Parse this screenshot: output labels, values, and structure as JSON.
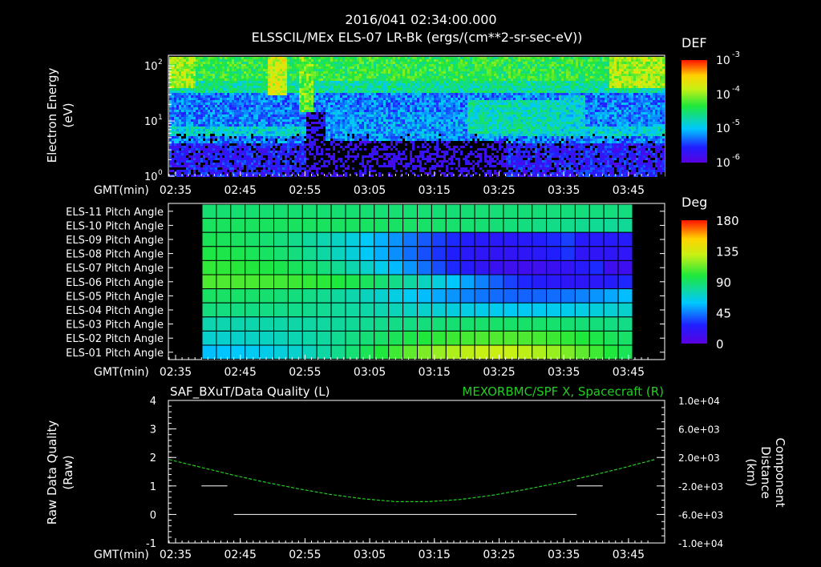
{
  "header": {
    "timestamp": "2016/041 02:34:00.000",
    "title": "ELSSCIL/MEx ELS-07 LR-Bk  (ergs/(cm**2-sr-sec-eV))"
  },
  "time_axis": {
    "label": "GMT(min)",
    "ticks": [
      "02:35",
      "02:45",
      "02:55",
      "03:05",
      "03:15",
      "03:25",
      "03:35",
      "03:45"
    ]
  },
  "chart_data": [
    {
      "type": "heatmap",
      "name": "electron-energy-spectrogram",
      "ylabel": [
        "Electron Energy",
        "(eV)"
      ],
      "y_scale": "log",
      "ylim": [
        1,
        150
      ],
      "y_ticks": [
        {
          "base": "10",
          "exp": "0"
        },
        {
          "base": "10",
          "exp": "1"
        },
        {
          "base": "10",
          "exp": "2"
        }
      ],
      "colorbar": {
        "label": "DEF",
        "ticks": [
          {
            "base": "10",
            "exp": "-3"
          },
          {
            "base": "10",
            "exp": "-4"
          },
          {
            "base": "10",
            "exp": "-5"
          },
          {
            "base": "10",
            "exp": "-6"
          }
        ]
      }
    },
    {
      "type": "heatmap",
      "name": "pitch-angle-map",
      "rows": [
        "ELS-11 Pitch Angle",
        "ELS-10 Pitch Angle",
        "ELS-09 Pitch Angle",
        "ELS-08 Pitch Angle",
        "ELS-07 Pitch Angle",
        "ELS-06 Pitch Angle",
        "ELS-05 Pitch Angle",
        "ELS-04 Pitch Angle",
        "ELS-03 Pitch Angle",
        "ELS-02 Pitch Angle",
        "ELS-01 Pitch Angle"
      ],
      "colorbar": {
        "label": "Deg",
        "ticks": [
          "180",
          "135",
          "90",
          "45",
          "0"
        ],
        "range": [
          0,
          180
        ]
      },
      "columns": 30,
      "row_start_deg": [
        88,
        92,
        96,
        100,
        104,
        108,
        92,
        86,
        75,
        68,
        55
      ],
      "row_min_deg": [
        85,
        80,
        22,
        18,
        12,
        20,
        40,
        62,
        90,
        108,
        130
      ],
      "min_minute_offset": [
        70,
        65,
        45,
        45,
        48,
        55,
        48,
        48,
        46,
        45,
        44
      ]
    },
    {
      "type": "line",
      "name": "data-quality-and-component-distance",
      "title_left": "SAF_BXuT/Data Quality (L)",
      "title_right": "MEXORBMC/SPF X, Spacecraft (R)",
      "ylabel_left": [
        "Raw Data Quality",
        "(Raw)"
      ],
      "ylabel_right": [
        "Component",
        "Distance",
        "(km)"
      ],
      "ylim_left": [
        -1,
        4
      ],
      "y_ticks_left": [
        "4",
        "3",
        "2",
        "1",
        "0",
        "-1"
      ],
      "ylim_right": [
        -10000,
        10000
      ],
      "y_ticks_right": [
        "1.0e+04",
        "6.0e+03",
        "2.0e+03",
        "-2.0e+03",
        "-6.0e+03",
        "-1.0e+04"
      ],
      "series": [
        {
          "color": "#ffffff",
          "segments": [
            {
              "x": [
                "02:39",
                "02:43"
              ],
              "y": [
                1,
                1
              ]
            },
            {
              "x": [
                "02:44",
                "03:37"
              ],
              "y": [
                0,
                0
              ]
            },
            {
              "x": [
                "03:37",
                "03:41"
              ],
              "y": [
                1,
                1
              ]
            }
          ]
        },
        {
          "color": "#22cc22",
          "axis": "right",
          "x": [
            "02:34",
            "02:39",
            "02:44",
            "02:49",
            "02:54",
            "02:59",
            "03:04",
            "03:09",
            "03:14",
            "03:19",
            "03:24",
            "03:29",
            "03:34",
            "03:39",
            "03:44",
            "03:49"
          ],
          "y": [
            1700,
            600,
            -500,
            -1500,
            -2400,
            -3200,
            -3800,
            -4200,
            -4200,
            -3900,
            -3300,
            -2500,
            -1600,
            -600,
            500,
            1700
          ]
        }
      ]
    }
  ],
  "colors": {
    "background": "#000000",
    "text": "#ffffff",
    "spf_line": "#22cc22"
  }
}
